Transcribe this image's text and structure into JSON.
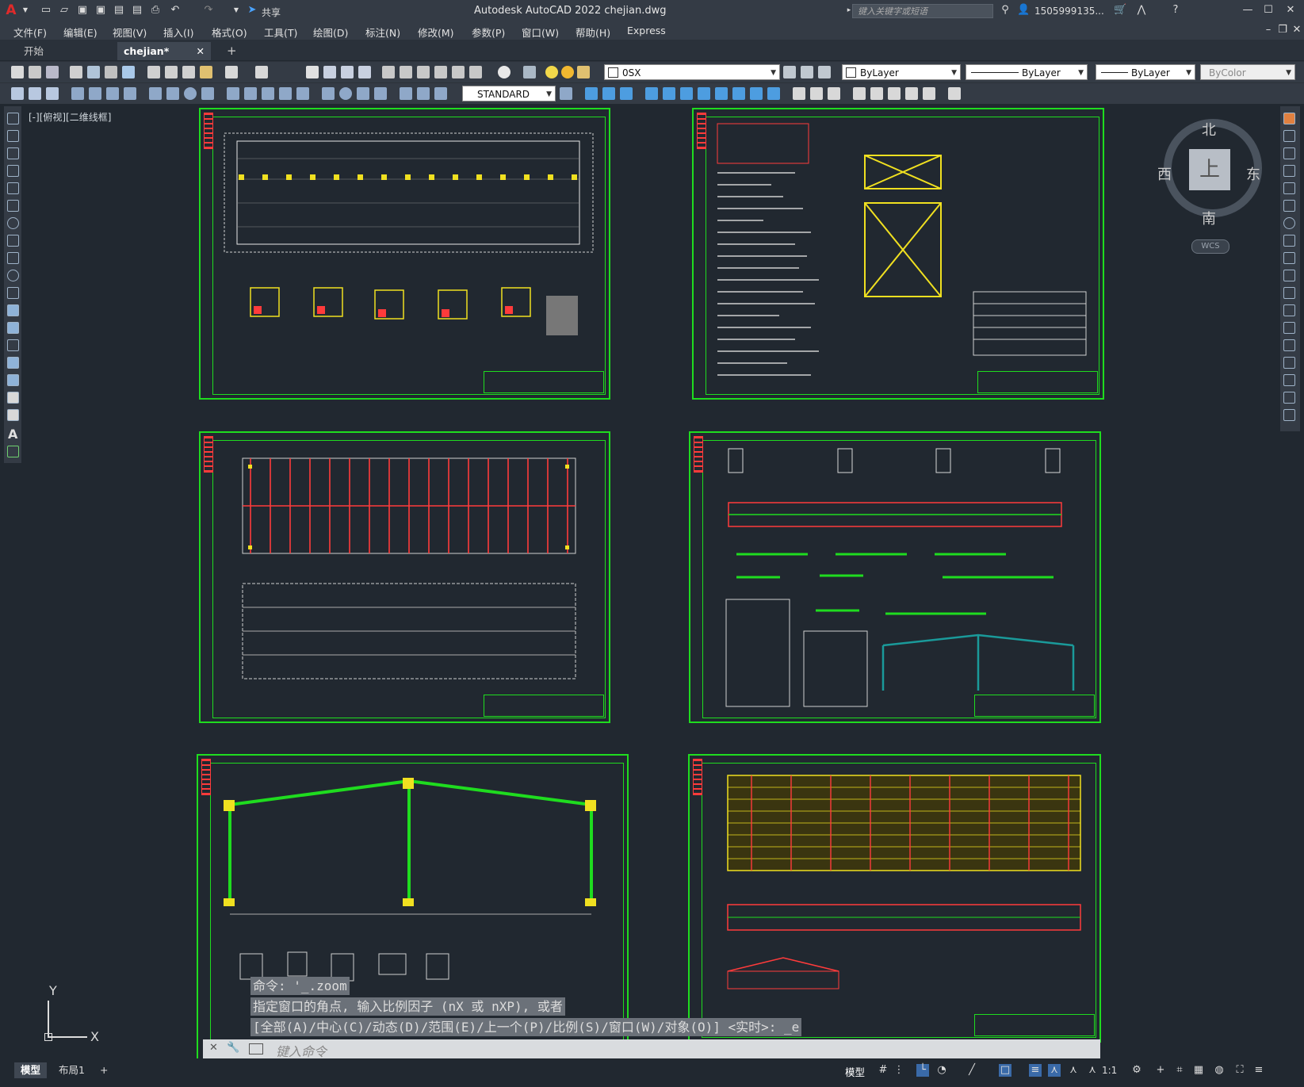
{
  "app": {
    "title": "Autodesk AutoCAD 2022    chejian.dwg",
    "search_placeholder": "键入关键字或短语",
    "user": "1505999135...",
    "share_label": "共享"
  },
  "menu": [
    "文件(F)",
    "编辑(E)",
    "视图(V)",
    "插入(I)",
    "格式(O)",
    "工具(T)",
    "绘图(D)",
    "标注(N)",
    "修改(M)",
    "参数(P)",
    "窗口(W)",
    "帮助(H)",
    "Express"
  ],
  "tabs": {
    "start": "开始",
    "active": "chejian*",
    "close": "✕",
    "add": "+"
  },
  "toolbar": {
    "layer": "0SX",
    "color": "ByLayer",
    "linetype": "ByLayer",
    "lineweight": "ByLayer",
    "plotstyle": "ByColor",
    "textstyle": "STANDARD"
  },
  "viewport": {
    "label": "[-][俯视][二维线框]"
  },
  "viewcube": {
    "north": "北",
    "south": "南",
    "east": "东",
    "west": "西",
    "top": "上",
    "wcs": "WCS"
  },
  "ucs": {
    "y": "Y",
    "x": "X"
  },
  "command": {
    "line1": "命令: '_.zoom",
    "line2": "指定窗口的角点, 输入比例因子 (nX 或 nXP), 或者",
    "line3": "[全部(A)/中心(C)/动态(D)/范围(E)/上一个(P)/比例(S)/窗口(W)/对象(O)] <实时>: _e",
    "placeholder": "键入命令"
  },
  "layout_tabs": [
    "模型",
    "布局1"
  ],
  "status": {
    "model": "模型",
    "scale": "1:1"
  },
  "colors": {
    "frame": "#1fdc1f",
    "background": "#212830",
    "accent_red": "#ff3b3b",
    "accent_yellow": "#f0e020"
  }
}
